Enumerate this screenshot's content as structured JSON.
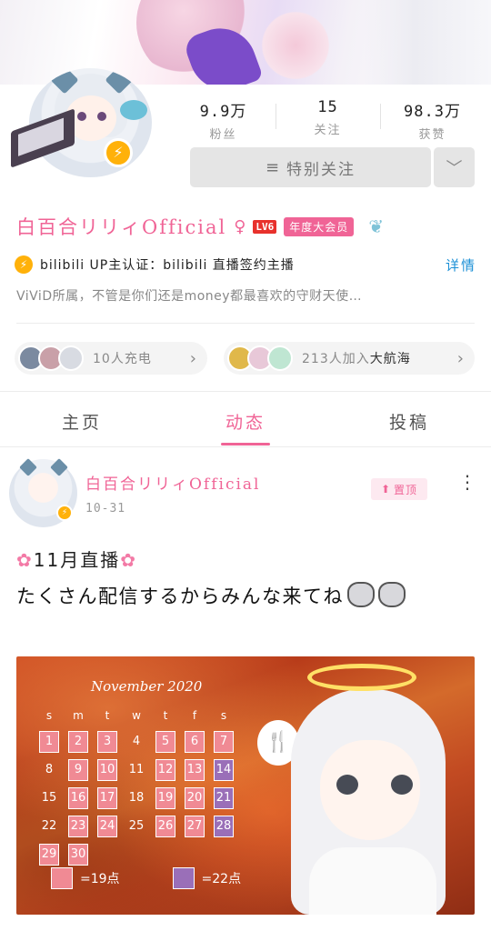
{
  "profile": {
    "name": "白百合リリィOfficial",
    "gender_symbol": "♀",
    "level": "LV6",
    "vip_badge": "年度大会员",
    "stats": [
      {
        "value": "9.9万",
        "label": "粉丝"
      },
      {
        "value": "15",
        "label": "关注"
      },
      {
        "value": "98.3万",
        "label": "获赞"
      }
    ],
    "follow_button": "特别关注",
    "certification": "bilibili UP主认证：bilibili 直播签约主播",
    "certification_detail": "详情",
    "bio": "ViViD所属，不管是你们还是money都最喜欢的守财天使…"
  },
  "pills": {
    "charge": "10人充电",
    "fleet_prefix": "213人加入",
    "fleet_name": "大航海"
  },
  "tabs": [
    {
      "label": "主页",
      "active": false
    },
    {
      "label": "动态",
      "active": true
    },
    {
      "label": "投稿",
      "active": false
    }
  ],
  "post": {
    "author": "白百合リリィOfficial",
    "date": "10-31",
    "pin_label": "置顶",
    "text_line1": "11月直播",
    "text_line2": "たくさん配信するからみんな来てね",
    "image": {
      "calendar_title": "November 2020",
      "weekdays": [
        "s",
        "m",
        "t",
        "w",
        "t",
        "f",
        "s"
      ],
      "days": [
        {
          "d": "1",
          "mark": "pink"
        },
        {
          "d": "2",
          "mark": "pink"
        },
        {
          "d": "3",
          "mark": "pink"
        },
        {
          "d": "4",
          "mark": ""
        },
        {
          "d": "5",
          "mark": "pink"
        },
        {
          "d": "6",
          "mark": "pink"
        },
        {
          "d": "7",
          "mark": "pink"
        },
        {
          "d": "8",
          "mark": ""
        },
        {
          "d": "9",
          "mark": "pink"
        },
        {
          "d": "10",
          "mark": "pink"
        },
        {
          "d": "11",
          "mark": ""
        },
        {
          "d": "12",
          "mark": "pink"
        },
        {
          "d": "13",
          "mark": "pink"
        },
        {
          "d": "14",
          "mark": "purple"
        },
        {
          "d": "15",
          "mark": ""
        },
        {
          "d": "16",
          "mark": "pink"
        },
        {
          "d": "17",
          "mark": "pink"
        },
        {
          "d": "18",
          "mark": ""
        },
        {
          "d": "19",
          "mark": "pink"
        },
        {
          "d": "20",
          "mark": "pink"
        },
        {
          "d": "21",
          "mark": "purple"
        },
        {
          "d": "22",
          "mark": ""
        },
        {
          "d": "23",
          "mark": "pink"
        },
        {
          "d": "24",
          "mark": "pink"
        },
        {
          "d": "25",
          "mark": ""
        },
        {
          "d": "26",
          "mark": "pink"
        },
        {
          "d": "27",
          "mark": "pink"
        },
        {
          "d": "28",
          "mark": "purple"
        },
        {
          "d": "29",
          "mark": "pink"
        },
        {
          "d": "30",
          "mark": "pink"
        }
      ],
      "legend_pink": "=19点",
      "legend_purple": "=22点"
    }
  },
  "colors": {
    "accent": "#f06496",
    "link": "#1a8fd6",
    "badge": "#ffb10a"
  }
}
